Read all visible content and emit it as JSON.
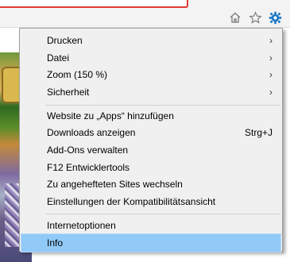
{
  "toolbar": {
    "icons": [
      "home-icon",
      "star-icon",
      "gear-icon"
    ],
    "accent": "#1e78c8"
  },
  "menu": {
    "group1": [
      {
        "label": "Drucken",
        "submenu": true
      },
      {
        "label": "Datei",
        "submenu": true
      },
      {
        "label": "Zoom (150 %)",
        "submenu": true
      },
      {
        "label": "Sicherheit",
        "submenu": true
      }
    ],
    "group2": [
      {
        "label": "Website zu „Apps“ hinzufügen"
      },
      {
        "label": "Downloads anzeigen",
        "shortcut": "Strg+J"
      },
      {
        "label": "Add-Ons verwalten"
      },
      {
        "label": "F12 Entwicklertools"
      },
      {
        "label": "Zu angehefteten Sites wechseln"
      },
      {
        "label": "Einstellungen der Kompatibilitätsansicht"
      }
    ],
    "group3": [
      {
        "label": "Internetoptionen"
      },
      {
        "label": "Info",
        "selected": true
      }
    ],
    "selected_color": "#91c9f7"
  }
}
